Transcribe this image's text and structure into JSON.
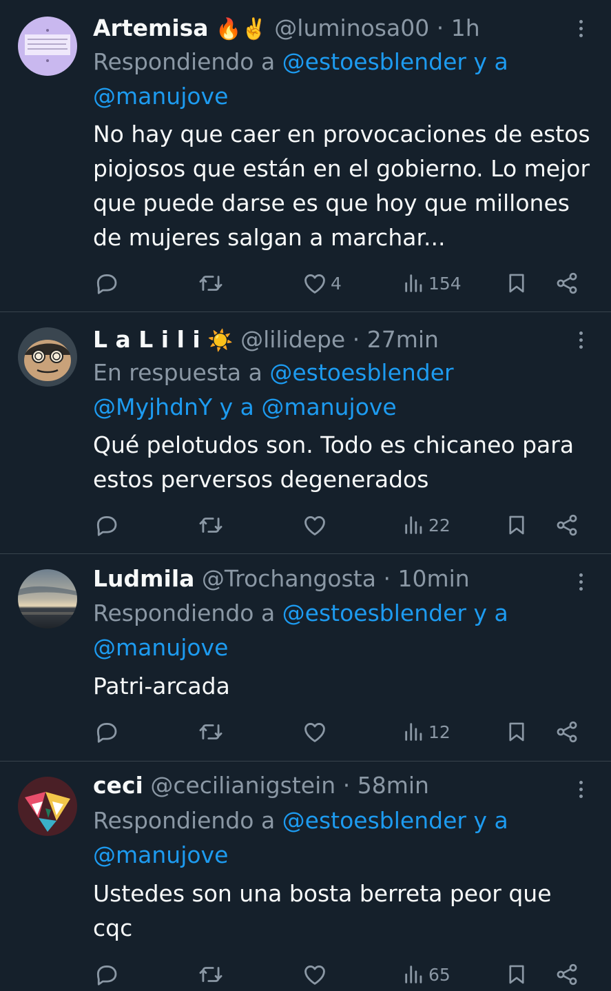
{
  "colors": {
    "background": "#15202b",
    "divider": "#38444d",
    "text": "#f7f9f9",
    "secondary": "#8b98a5",
    "link": "#1d9bf0"
  },
  "tweets": [
    {
      "name": "Artemisa",
      "name_emoji": "🔥✌️",
      "handle": "@luminosa00",
      "dot": "·",
      "time": "1h",
      "reply_prefix": "Respondiendo a ",
      "reply_mention_1": "@estoesblender",
      "reply_connector": " y a ",
      "reply_mention_2": "@manujove",
      "reply_mention_3": "",
      "text": "No hay que caer en provocaciones de estos piojosos que están en el gobierno. Lo mejor que puede darse es que hoy que millones de mujeres salgan a marchar...",
      "like_count": "4",
      "view_count": "154",
      "avatar_icon": "lilac-quote-card-avatar"
    },
    {
      "name": "L a L i l i",
      "name_emoji": "☀️",
      "handle": "@lilidepe",
      "dot": "·",
      "time": "27min",
      "reply_prefix": "En respuesta a ",
      "reply_mention_1": "@estoesblender",
      "reply_connector": " y a ",
      "reply_mention_2": "@MyjhdnY",
      "reply_mention_3": "@manujove",
      "text": "Qué pelotudos son. Todo es chicaneo para estos perversos degenerados",
      "like_count": "",
      "view_count": "22",
      "avatar_icon": "spiral-eyes-face-avatar"
    },
    {
      "name": "Ludmila",
      "name_emoji": "",
      "handle": "@Trochangosta",
      "dot": "·",
      "time": "10min",
      "reply_prefix": "Respondiendo a ",
      "reply_mention_1": "@estoesblender",
      "reply_connector": " y a ",
      "reply_mention_2": "@manujove",
      "reply_mention_3": "",
      "text": "Patri-arcada",
      "like_count": "",
      "view_count": "12",
      "avatar_icon": "sunset-beach-avatar"
    },
    {
      "name": "ceci",
      "name_emoji": "",
      "handle": "@cecilianigstein",
      "dot": "·",
      "time": "58min",
      "reply_prefix": "Respondiendo a ",
      "reply_mention_1": "@estoesblender",
      "reply_connector": " y a ",
      "reply_mention_2": "@manujove",
      "reply_mention_3": "",
      "text": "Ustedes son una bosta berreta peor que cqc",
      "like_count": "",
      "view_count": "65",
      "avatar_icon": "colorful-geometric-avatar"
    }
  ]
}
